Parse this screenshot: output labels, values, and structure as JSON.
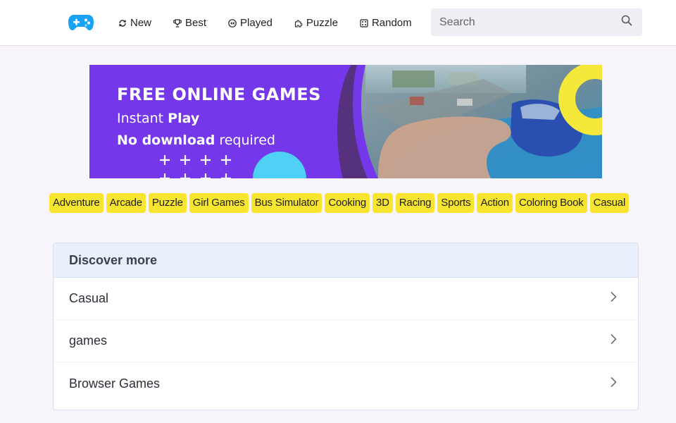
{
  "header": {
    "logo_icon": "gamepad-icon",
    "nav": [
      {
        "label": "New",
        "icon": "refresh-icon"
      },
      {
        "label": "Best",
        "icon": "trophy-icon"
      },
      {
        "label": "Played",
        "icon": "rewind-icon"
      },
      {
        "label": "Puzzle",
        "icon": "puzzle-icon"
      },
      {
        "label": "Random",
        "icon": "dice-icon"
      }
    ],
    "search": {
      "placeholder": "Search",
      "value": ""
    }
  },
  "banner": {
    "line1": "FREE ONLINE GAMES",
    "line2_prefix": "Instant ",
    "line2_bold": "Play",
    "line3_bold": "No download",
    "line3_suffix": " required"
  },
  "categories": [
    "Adventure",
    "Arcade",
    "Puzzle",
    "Girl Games",
    "Bus Simulator",
    "Cooking",
    "3D",
    "Racing",
    "Sports",
    "Action",
    "Coloring Book",
    "Casual"
  ],
  "discover": {
    "title": "Discover more",
    "items": [
      "Casual",
      "games",
      "Browser Games"
    ]
  },
  "colors": {
    "brand_purple": "#7437ea",
    "chip_yellow": "#f7e52f",
    "logo_blue": "#1aa3f5",
    "banner_yellow": "#f4e83a",
    "banner_cyan": "#4fd0f5"
  }
}
